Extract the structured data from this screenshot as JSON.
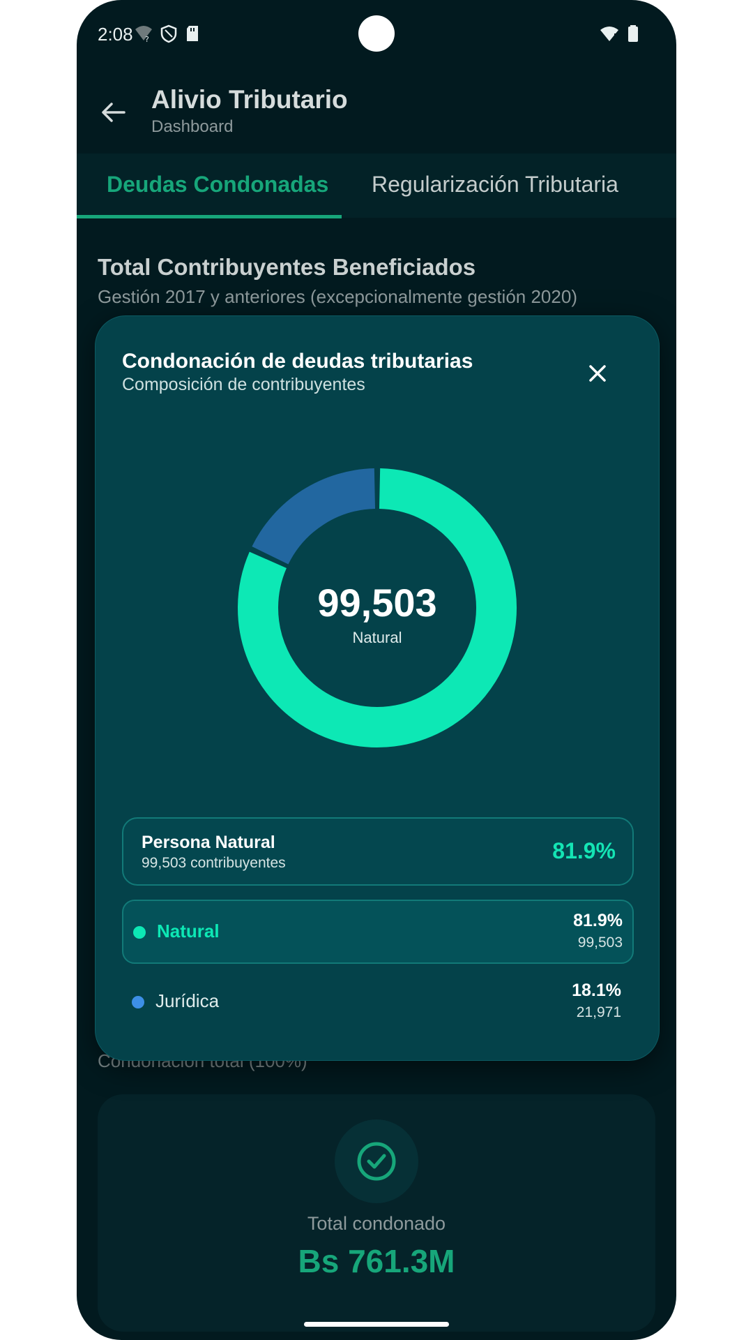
{
  "status_bar": {
    "time": "2:08",
    "icons": [
      "wifi-unknown-icon",
      "shield-icon",
      "sd-card-icon",
      "wifi-icon",
      "battery-icon"
    ]
  },
  "app_bar": {
    "title": "Alivio Tributario",
    "subtitle": "Dashboard",
    "back_icon": "arrow-back-icon"
  },
  "tabs": [
    {
      "label": "Deudas Condonadas",
      "active": true
    },
    {
      "label": "Regularización Tributaria",
      "active": false
    }
  ],
  "section": {
    "title": "Total Contribuyentes Beneficiados",
    "subtitle": "Gestión 2017 y anteriores (excepcionalmente gestión 2020)",
    "partially_hidden_label": "Condonación total (100%)"
  },
  "total_card": {
    "icon": "check-circle-icon",
    "label": "Total condonado",
    "value": "Bs 761.3M"
  },
  "dialog": {
    "title": "Condonación de deudas tributarias",
    "subtitle": "Composición de contribuyentes",
    "close_icon": "close-icon",
    "center_value": "99,503",
    "center_label": "Natural",
    "summary": {
      "name": "Persona Natural",
      "count_text": "99,503 contribuyentes",
      "percent": "81.9%"
    },
    "legend": [
      {
        "name": "Natural",
        "percent": "81.9%",
        "count": "99,503",
        "color": "#0de8b5",
        "selected": true
      },
      {
        "name": "Jurídica",
        "percent": "18.1%",
        "count": "21,971",
        "color": "#3d8fe6",
        "selected": false
      }
    ]
  },
  "chart_data": {
    "type": "pie",
    "categories": [
      "Natural",
      "Jurídica"
    ],
    "values": [
      99503,
      21971
    ],
    "percentages": [
      81.9,
      18.1
    ],
    "colors": [
      "#0de8b5",
      "#2267a0"
    ]
  }
}
